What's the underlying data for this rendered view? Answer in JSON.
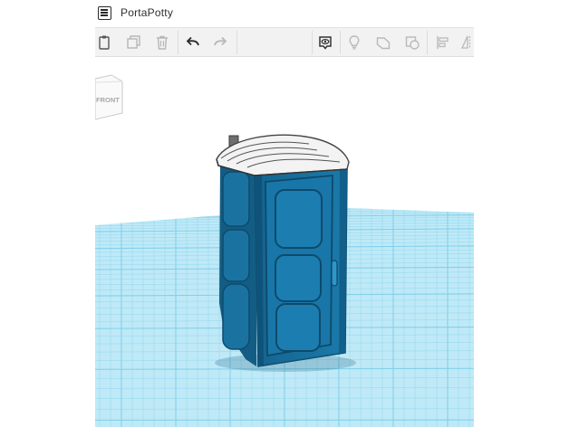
{
  "window": {
    "title": "PortaPotty",
    "menu_icon": "list-menu-icon"
  },
  "toolbar": {
    "left_tools": [
      {
        "name": "paste",
        "icon": "clipboard-icon"
      },
      {
        "name": "duplicate",
        "icon": "duplicate-icon"
      },
      {
        "name": "delete",
        "icon": "trash-icon"
      },
      {
        "name": "undo",
        "icon": "undo-arrow-icon"
      },
      {
        "name": "redo",
        "icon": "redo-arrow-icon"
      }
    ],
    "right_tools": [
      {
        "name": "notes",
        "icon": "eye-speech-icon"
      },
      {
        "name": "light",
        "icon": "lightbulb-icon"
      },
      {
        "name": "shape",
        "icon": "shape-icon"
      },
      {
        "name": "hole",
        "icon": "hole-shape-icon"
      },
      {
        "name": "align",
        "icon": "align-icon"
      },
      {
        "name": "mirror",
        "icon": "mirror-icon"
      }
    ]
  },
  "viewcube": {
    "face_label": "FRONT"
  },
  "scene": {
    "object": "portable toilet",
    "body_color": "#1a76a6",
    "body_dark_color": "#105679",
    "roof_color": "#f1f1f1",
    "grid_color": "#7fd0ea",
    "grid_background": "#bfe9f7"
  }
}
